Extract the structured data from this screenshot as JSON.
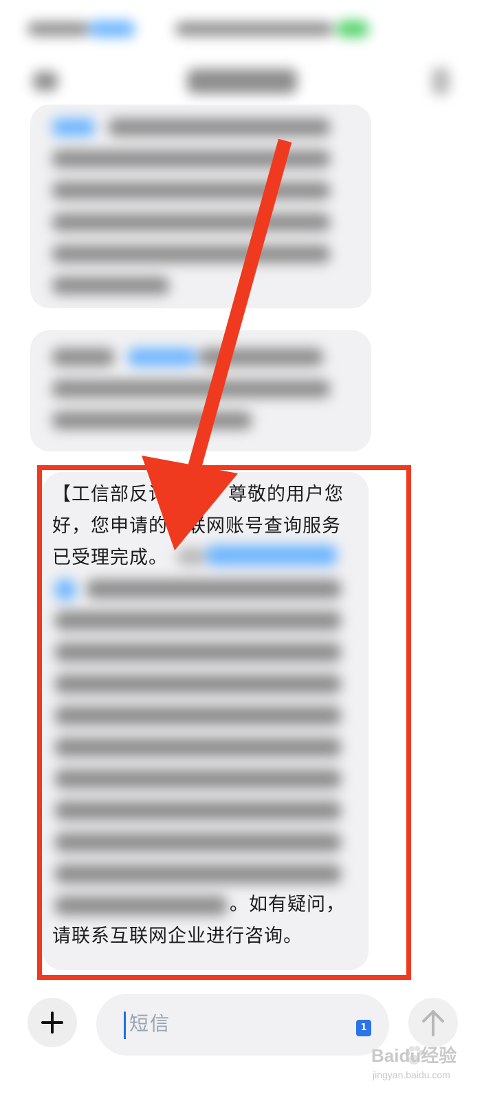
{
  "message": {
    "line1": "【工信部反诈",
    "line1b": "】尊敬的用户您",
    "line2": "好，您申请的",
    "line2b": "联网账号查询服务",
    "line3": "已受理完成。",
    "tail1": "。如有疑问，",
    "tail2": "请联系互联网企业进行咨询。"
  },
  "composer": {
    "placeholder": "短信",
    "sim_badge": "1",
    "add_icon": "plus-icon",
    "send_icon": "arrow-up-icon"
  },
  "watermark": {
    "brand": "Baidu经验",
    "url": "jingyan.baidu.com"
  },
  "colors": {
    "annotation_red": "#ef3a1f",
    "bubble_bg": "#f1f1f3",
    "caret_blue": "#1e6fe6",
    "sim_blue": "#2a73e8"
  }
}
